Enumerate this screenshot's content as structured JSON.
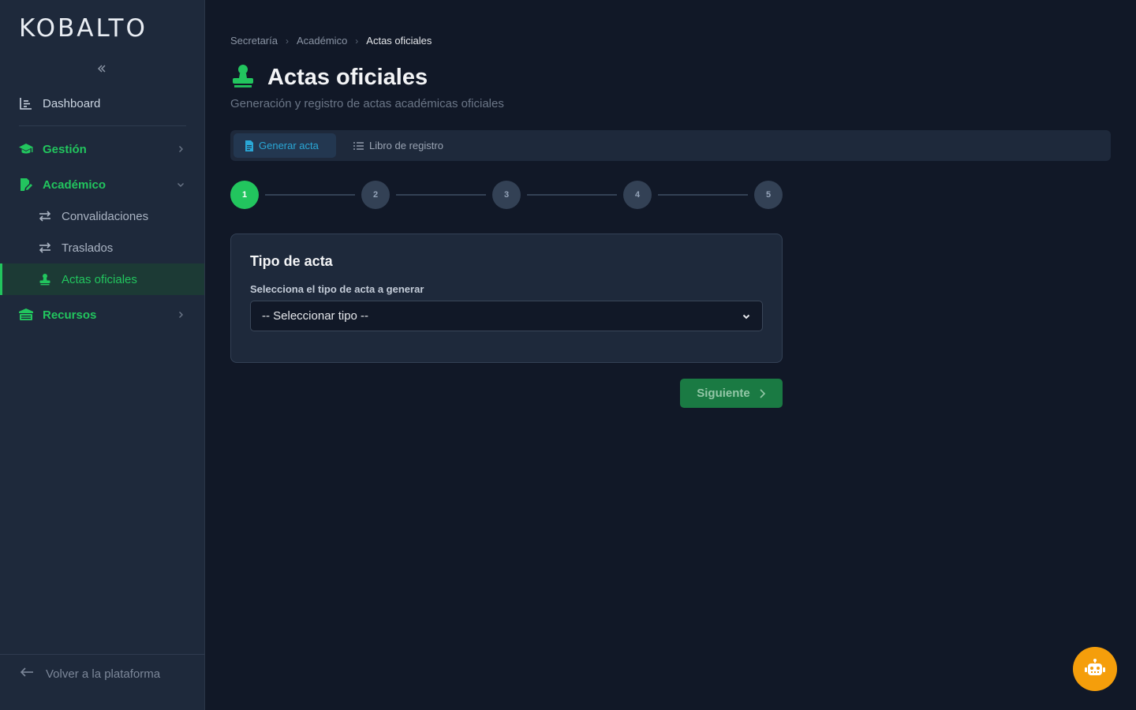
{
  "brand": {
    "logo": "KOBALTO"
  },
  "colors": {
    "accent_green": "#22c55e",
    "accent_blue": "#2aa7d6",
    "bot_orange": "#f59e0b",
    "bg": "#111827",
    "sidebar_bg": "#1e293b"
  },
  "sidebar": {
    "collapse_icon": "double-chevron-left-icon",
    "dashboard": {
      "label": "Dashboard",
      "icon": "chart-icon"
    },
    "groups": [
      {
        "label": "Gestión",
        "icon": "graduation-cap-icon",
        "expanded": false
      },
      {
        "label": "Académico",
        "icon": "document-edit-icon",
        "expanded": true,
        "items": [
          {
            "label": "Convalidaciones",
            "icon": "swap-icon"
          },
          {
            "label": "Traslados",
            "icon": "swap-icon"
          },
          {
            "label": "Actas oficiales",
            "icon": "stamp-icon",
            "active": true
          }
        ]
      },
      {
        "label": "Recursos",
        "icon": "building-icon",
        "expanded": false
      }
    ],
    "back_link": "Volver a la plataforma"
  },
  "breadcrumb": [
    "Secretaría",
    "Académico",
    "Actas oficiales"
  ],
  "page": {
    "title": "Actas oficiales",
    "subtitle": "Generación y registro de actas académicas oficiales"
  },
  "tabs": [
    {
      "label": "Generar acta",
      "active": true
    },
    {
      "label": "Libro de registro",
      "active": false
    }
  ],
  "stepper": {
    "steps": [
      "1",
      "2",
      "3",
      "4",
      "5"
    ],
    "current": 1
  },
  "card": {
    "title": "Tipo de acta",
    "field_label": "Selecciona el tipo de acta a generar",
    "select_value": "-- Seleccionar tipo --"
  },
  "actions": {
    "next_label": "Siguiente"
  }
}
